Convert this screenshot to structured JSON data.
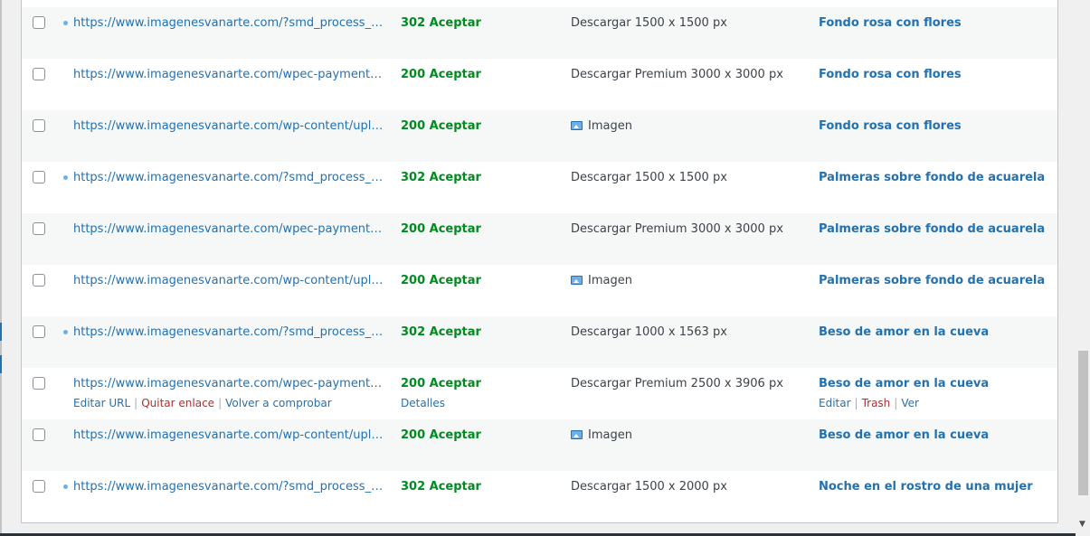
{
  "rows": [
    {
      "url": "https://www.imagenesvanarte.com/?smd_process_downlo...",
      "redirect": true,
      "status": "302 Aceptar",
      "link_text": "Descargar 1500 x 1500 px",
      "link_icon": "",
      "source": "Fondo rosa con flores"
    },
    {
      "url": "https://www.imagenesvanarte.com/wpec-payment-box/?...",
      "redirect": false,
      "status": "200 Aceptar",
      "link_text": "Descargar Premium 3000 x 3000 px",
      "link_icon": "",
      "source": "Fondo rosa con flores"
    },
    {
      "url": "https://www.imagenesvanarte.com/wp-content/uploads/...",
      "redirect": false,
      "status": "200 Aceptar",
      "link_text": "Imagen",
      "link_icon": "image-icon",
      "source": "Fondo rosa con flores"
    },
    {
      "url": "https://www.imagenesvanarte.com/?smd_process_downlo...",
      "redirect": true,
      "status": "302 Aceptar",
      "link_text": "Descargar 1500 x 1500 px",
      "link_icon": "",
      "source": "Palmeras sobre fondo de acuarela"
    },
    {
      "url": "https://www.imagenesvanarte.com/wpec-payment-box/?...",
      "redirect": false,
      "status": "200 Aceptar",
      "link_text": "Descargar Premium 3000 x 3000 px",
      "link_icon": "",
      "source": "Palmeras sobre fondo de acuarela"
    },
    {
      "url": "https://www.imagenesvanarte.com/wp-content/uploads/...",
      "redirect": false,
      "status": "200 Aceptar",
      "link_text": "Imagen",
      "link_icon": "image-icon",
      "source": "Palmeras sobre fondo de acuarela"
    },
    {
      "url": "https://www.imagenesvanarte.com/?smd_process_downlo...",
      "redirect": true,
      "status": "302 Aceptar",
      "link_text": "Descargar 1000 x 1563 px",
      "link_icon": "",
      "source": "Beso de amor en la cueva"
    },
    {
      "url": "https://www.imagenesvanarte.com/wpec-payment-box/?...",
      "redirect": false,
      "status": "200 Aceptar",
      "link_text": "Descargar Premium 2500 x 3906 px",
      "link_icon": "",
      "source": "Beso de amor en la cueva"
    },
    {
      "url": "https://www.imagenesvanarte.com/wp-content/uploads/...",
      "redirect": false,
      "status": "200 Aceptar",
      "link_text": "Imagen",
      "link_icon": "image-icon",
      "source": "Beso de amor en la cueva"
    },
    {
      "url": "https://www.imagenesvanarte.com/?smd_process_downlo...",
      "redirect": true,
      "status": "302 Aceptar",
      "link_text": "Descargar 1500 x 2000 px",
      "link_icon": "",
      "source": "Noche en el rostro de una mujer"
    }
  ],
  "hover_row": {
    "url_actions": {
      "edit": "Editar URL",
      "unlink": "Quitar enlace",
      "recheck": "Volver a comprobar"
    },
    "status_actions": {
      "details": "Detalles"
    },
    "source_actions": {
      "edit": "Editar",
      "trash": "Trash",
      "view": "Ver"
    },
    "separator": "|"
  },
  "colors": {
    "link": "#2271b1",
    "status_ok": "#008a20",
    "delete": "#b32d2e",
    "muted": "#a7aaad",
    "alt_row": "#f6f7f7"
  }
}
